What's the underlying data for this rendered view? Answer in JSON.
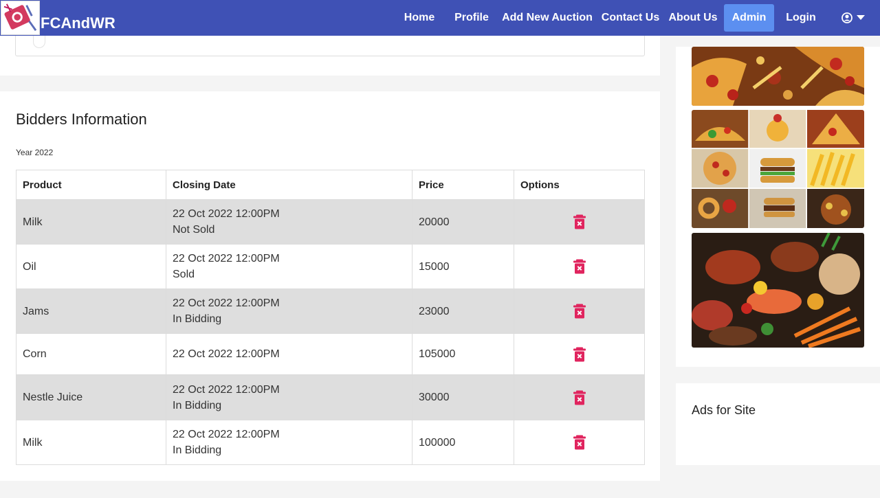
{
  "brand": {
    "name": "FCAndWR",
    "logo_icon": "food-logo-icon"
  },
  "nav": {
    "items": [
      {
        "label": "Home"
      },
      {
        "label": "Profile"
      },
      {
        "label": "Add New Auction"
      },
      {
        "label": "Contact Us"
      },
      {
        "label": "About Us"
      },
      {
        "label": "Admin",
        "active": true
      },
      {
        "label": "Login"
      }
    ],
    "account_icon": "user-circle-icon",
    "dropdown_icon": "caret-down-icon"
  },
  "section": {
    "title": "Bidders Information",
    "subtitle": "Year 2022"
  },
  "table": {
    "headers": [
      "Product",
      "Closing Date",
      "Price",
      "Options"
    ],
    "rows": [
      {
        "product": "Milk",
        "closing_date": "22 Oct 2022 12:00PM",
        "status": "Not Sold",
        "price": "20000"
      },
      {
        "product": "Oil",
        "closing_date": "22 Oct 2022 12:00PM",
        "status": "Sold",
        "price": "15000"
      },
      {
        "product": "Jams",
        "closing_date": "22 Oct 2022 12:00PM",
        "status": "In Bidding",
        "price": "23000"
      },
      {
        "product": "Corn",
        "closing_date": "22 Oct 2022 12:00PM",
        "status": "",
        "price": "105000"
      },
      {
        "product": "Nestle Juice",
        "closing_date": "22 Oct 2022 12:00PM",
        "status": "In Bidding",
        "price": "30000"
      },
      {
        "product": "Milk",
        "closing_date": "22 Oct 2022 12:00PM",
        "status": "In Bidding",
        "price": "100000"
      }
    ],
    "delete_icon": "trash-delete-icon"
  },
  "sidebar": {
    "ads_title": "Ads for Site",
    "images": [
      "pizza-image",
      "food-collage-image",
      "produce-image"
    ]
  },
  "colors": {
    "navbar": "#3f51b5",
    "nav_active": "#5c8ff0",
    "row_shade": "#dedede",
    "delete": "#e0245e"
  }
}
